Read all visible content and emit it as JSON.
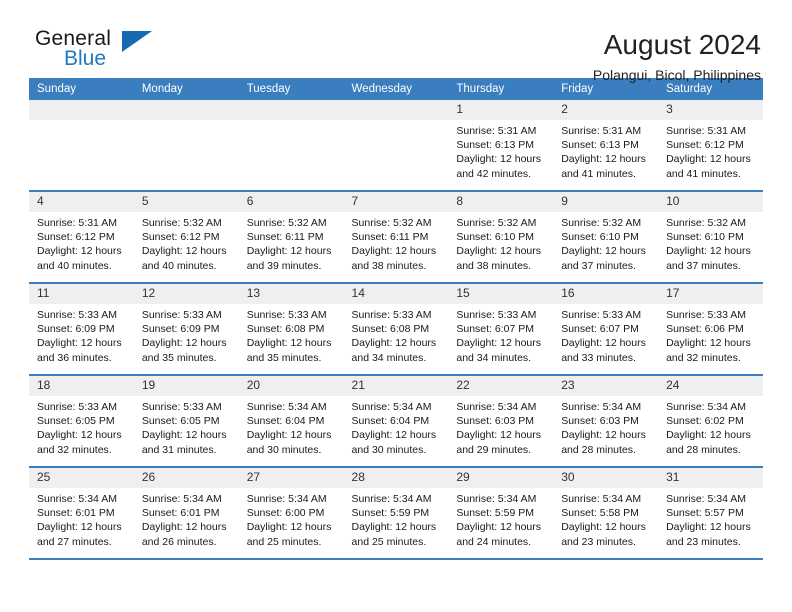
{
  "brand": {
    "name_top": "General",
    "name_bottom": "Blue",
    "triangle_color": "#1769b0",
    "blue_color": "#1f7ac4"
  },
  "header": {
    "title": "August 2024",
    "subtitle": "Polangui, Bicol, Philippines"
  },
  "theme": {
    "header_blue": "#3a7ebf",
    "daynum_bg": "#efefef",
    "text": "#1a1a1a"
  },
  "weekday_headers": [
    "Sunday",
    "Monday",
    "Tuesday",
    "Wednesday",
    "Thursday",
    "Friday",
    "Saturday"
  ],
  "labels": {
    "sunrise_prefix": "Sunrise:",
    "sunset_prefix": "Sunset:",
    "daylight_prefix": "Daylight:"
  },
  "weeks": [
    [
      {
        "day": "",
        "sunrise": "",
        "sunset": "",
        "daylight": "",
        "empty": true
      },
      {
        "day": "",
        "sunrise": "",
        "sunset": "",
        "daylight": "",
        "empty": true
      },
      {
        "day": "",
        "sunrise": "",
        "sunset": "",
        "daylight": "",
        "empty": true
      },
      {
        "day": "",
        "sunrise": "",
        "sunset": "",
        "daylight": "",
        "empty": true
      },
      {
        "day": "1",
        "sunrise": "Sunrise: 5:31 AM",
        "sunset": "Sunset: 6:13 PM",
        "daylight": "Daylight: 12 hours and 42 minutes.",
        "empty": false
      },
      {
        "day": "2",
        "sunrise": "Sunrise: 5:31 AM",
        "sunset": "Sunset: 6:13 PM",
        "daylight": "Daylight: 12 hours and 41 minutes.",
        "empty": false
      },
      {
        "day": "3",
        "sunrise": "Sunrise: 5:31 AM",
        "sunset": "Sunset: 6:12 PM",
        "daylight": "Daylight: 12 hours and 41 minutes.",
        "empty": false
      }
    ],
    [
      {
        "day": "4",
        "sunrise": "Sunrise: 5:31 AM",
        "sunset": "Sunset: 6:12 PM",
        "daylight": "Daylight: 12 hours and 40 minutes.",
        "empty": false
      },
      {
        "day": "5",
        "sunrise": "Sunrise: 5:32 AM",
        "sunset": "Sunset: 6:12 PM",
        "daylight": "Daylight: 12 hours and 40 minutes.",
        "empty": false
      },
      {
        "day": "6",
        "sunrise": "Sunrise: 5:32 AM",
        "sunset": "Sunset: 6:11 PM",
        "daylight": "Daylight: 12 hours and 39 minutes.",
        "empty": false
      },
      {
        "day": "7",
        "sunrise": "Sunrise: 5:32 AM",
        "sunset": "Sunset: 6:11 PM",
        "daylight": "Daylight: 12 hours and 38 minutes.",
        "empty": false
      },
      {
        "day": "8",
        "sunrise": "Sunrise: 5:32 AM",
        "sunset": "Sunset: 6:10 PM",
        "daylight": "Daylight: 12 hours and 38 minutes.",
        "empty": false
      },
      {
        "day": "9",
        "sunrise": "Sunrise: 5:32 AM",
        "sunset": "Sunset: 6:10 PM",
        "daylight": "Daylight: 12 hours and 37 minutes.",
        "empty": false
      },
      {
        "day": "10",
        "sunrise": "Sunrise: 5:32 AM",
        "sunset": "Sunset: 6:10 PM",
        "daylight": "Daylight: 12 hours and 37 minutes.",
        "empty": false
      }
    ],
    [
      {
        "day": "11",
        "sunrise": "Sunrise: 5:33 AM",
        "sunset": "Sunset: 6:09 PM",
        "daylight": "Daylight: 12 hours and 36 minutes.",
        "empty": false
      },
      {
        "day": "12",
        "sunrise": "Sunrise: 5:33 AM",
        "sunset": "Sunset: 6:09 PM",
        "daylight": "Daylight: 12 hours and 35 minutes.",
        "empty": false
      },
      {
        "day": "13",
        "sunrise": "Sunrise: 5:33 AM",
        "sunset": "Sunset: 6:08 PM",
        "daylight": "Daylight: 12 hours and 35 minutes.",
        "empty": false
      },
      {
        "day": "14",
        "sunrise": "Sunrise: 5:33 AM",
        "sunset": "Sunset: 6:08 PM",
        "daylight": "Daylight: 12 hours and 34 minutes.",
        "empty": false
      },
      {
        "day": "15",
        "sunrise": "Sunrise: 5:33 AM",
        "sunset": "Sunset: 6:07 PM",
        "daylight": "Daylight: 12 hours and 34 minutes.",
        "empty": false
      },
      {
        "day": "16",
        "sunrise": "Sunrise: 5:33 AM",
        "sunset": "Sunset: 6:07 PM",
        "daylight": "Daylight: 12 hours and 33 minutes.",
        "empty": false
      },
      {
        "day": "17",
        "sunrise": "Sunrise: 5:33 AM",
        "sunset": "Sunset: 6:06 PM",
        "daylight": "Daylight: 12 hours and 32 minutes.",
        "empty": false
      }
    ],
    [
      {
        "day": "18",
        "sunrise": "Sunrise: 5:33 AM",
        "sunset": "Sunset: 6:05 PM",
        "daylight": "Daylight: 12 hours and 32 minutes.",
        "empty": false
      },
      {
        "day": "19",
        "sunrise": "Sunrise: 5:33 AM",
        "sunset": "Sunset: 6:05 PM",
        "daylight": "Daylight: 12 hours and 31 minutes.",
        "empty": false
      },
      {
        "day": "20",
        "sunrise": "Sunrise: 5:34 AM",
        "sunset": "Sunset: 6:04 PM",
        "daylight": "Daylight: 12 hours and 30 minutes.",
        "empty": false
      },
      {
        "day": "21",
        "sunrise": "Sunrise: 5:34 AM",
        "sunset": "Sunset: 6:04 PM",
        "daylight": "Daylight: 12 hours and 30 minutes.",
        "empty": false
      },
      {
        "day": "22",
        "sunrise": "Sunrise: 5:34 AM",
        "sunset": "Sunset: 6:03 PM",
        "daylight": "Daylight: 12 hours and 29 minutes.",
        "empty": false
      },
      {
        "day": "23",
        "sunrise": "Sunrise: 5:34 AM",
        "sunset": "Sunset: 6:03 PM",
        "daylight": "Daylight: 12 hours and 28 minutes.",
        "empty": false
      },
      {
        "day": "24",
        "sunrise": "Sunrise: 5:34 AM",
        "sunset": "Sunset: 6:02 PM",
        "daylight": "Daylight: 12 hours and 28 minutes.",
        "empty": false
      }
    ],
    [
      {
        "day": "25",
        "sunrise": "Sunrise: 5:34 AM",
        "sunset": "Sunset: 6:01 PM",
        "daylight": "Daylight: 12 hours and 27 minutes.",
        "empty": false
      },
      {
        "day": "26",
        "sunrise": "Sunrise: 5:34 AM",
        "sunset": "Sunset: 6:01 PM",
        "daylight": "Daylight: 12 hours and 26 minutes.",
        "empty": false
      },
      {
        "day": "27",
        "sunrise": "Sunrise: 5:34 AM",
        "sunset": "Sunset: 6:00 PM",
        "daylight": "Daylight: 12 hours and 25 minutes.",
        "empty": false
      },
      {
        "day": "28",
        "sunrise": "Sunrise: 5:34 AM",
        "sunset": "Sunset: 5:59 PM",
        "daylight": "Daylight: 12 hours and 25 minutes.",
        "empty": false
      },
      {
        "day": "29",
        "sunrise": "Sunrise: 5:34 AM",
        "sunset": "Sunset: 5:59 PM",
        "daylight": "Daylight: 12 hours and 24 minutes.",
        "empty": false
      },
      {
        "day": "30",
        "sunrise": "Sunrise: 5:34 AM",
        "sunset": "Sunset: 5:58 PM",
        "daylight": "Daylight: 12 hours and 23 minutes.",
        "empty": false
      },
      {
        "day": "31",
        "sunrise": "Sunrise: 5:34 AM",
        "sunset": "Sunset: 5:57 PM",
        "daylight": "Daylight: 12 hours and 23 minutes.",
        "empty": false
      }
    ]
  ]
}
